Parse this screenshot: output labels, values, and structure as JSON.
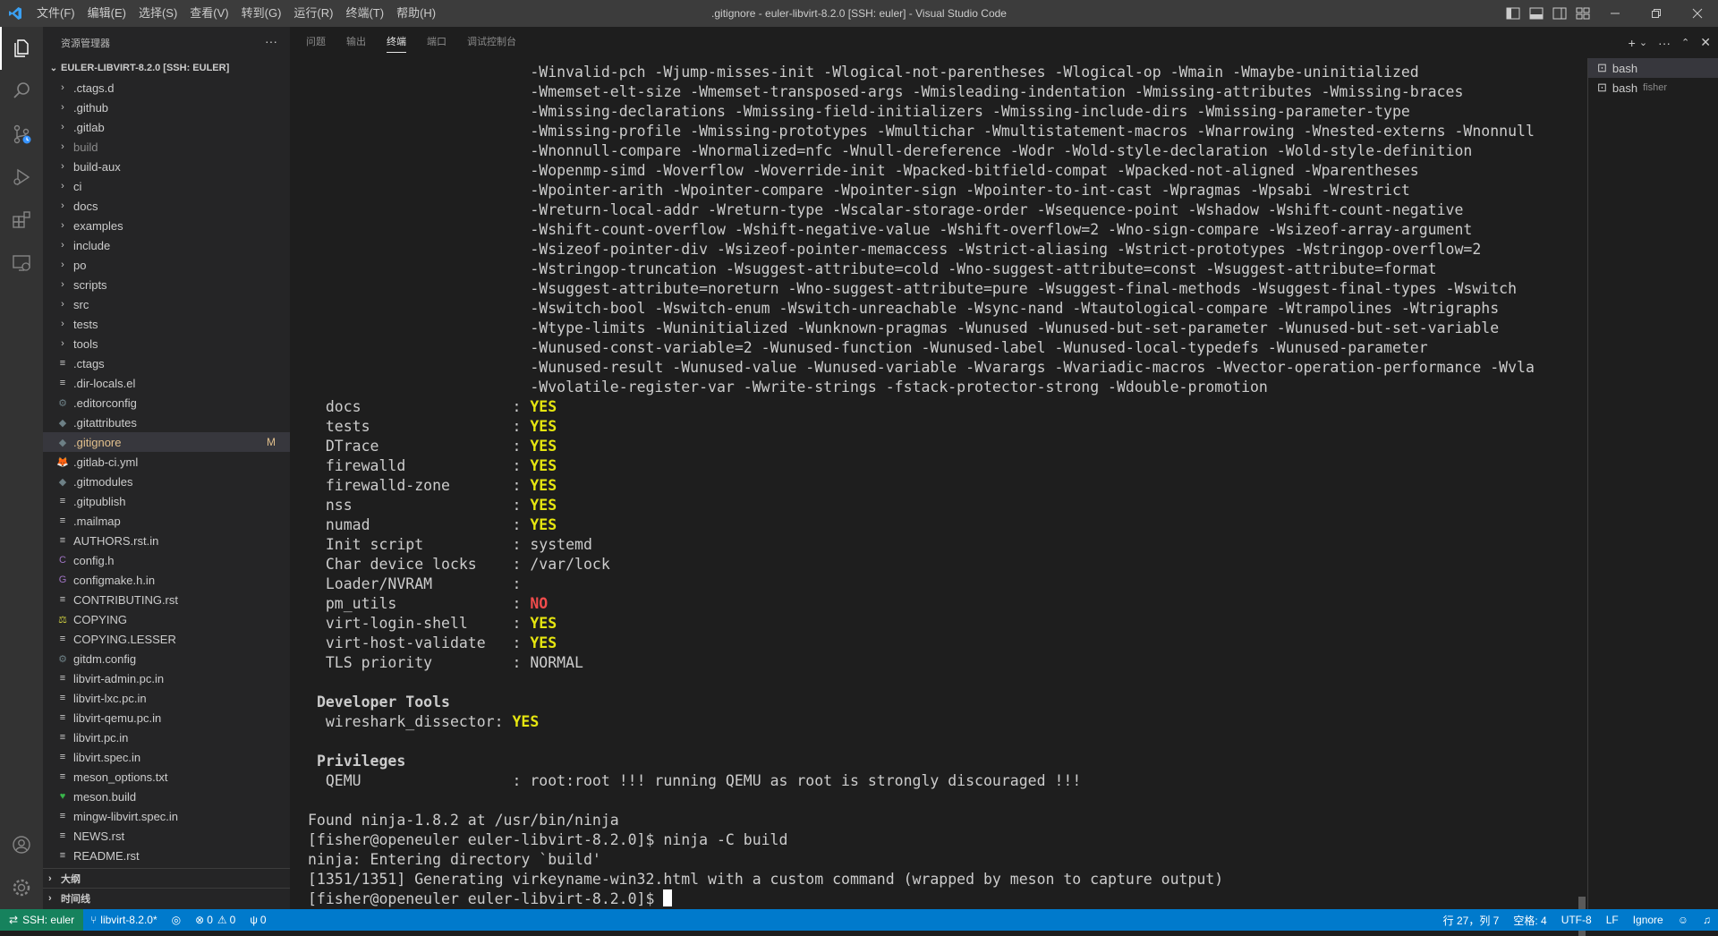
{
  "window": {
    "title": ".gitignore - euler-libvirt-8.2.0 [SSH: euler] - Visual Studio Code",
    "menu": [
      "文件(F)",
      "编辑(E)",
      "选择(S)",
      "查看(V)",
      "转到(G)",
      "运行(R)",
      "终端(T)",
      "帮助(H)"
    ]
  },
  "sidebar": {
    "header": "资源管理器",
    "more": "···",
    "root": "EULER-LIBVIRT-8.2.0 [SSH: EULER]",
    "items": [
      {
        "label": ".ctags.d",
        "type": "folder"
      },
      {
        "label": ".github",
        "type": "folder"
      },
      {
        "label": ".gitlab",
        "type": "folder"
      },
      {
        "label": "build",
        "type": "folder",
        "dim": true
      },
      {
        "label": "build-aux",
        "type": "folder"
      },
      {
        "label": "ci",
        "type": "folder"
      },
      {
        "label": "docs",
        "type": "folder"
      },
      {
        "label": "examples",
        "type": "folder"
      },
      {
        "label": "include",
        "type": "folder"
      },
      {
        "label": "po",
        "type": "folder"
      },
      {
        "label": "scripts",
        "type": "folder"
      },
      {
        "label": "src",
        "type": "folder"
      },
      {
        "label": "tests",
        "type": "folder"
      },
      {
        "label": "tools",
        "type": "folder"
      },
      {
        "label": ".ctags",
        "type": "file",
        "icon": "≡"
      },
      {
        "label": ".dir-locals.el",
        "type": "file",
        "icon": "≡"
      },
      {
        "label": ".editorconfig",
        "type": "file",
        "icon": "⚙"
      },
      {
        "label": ".gitattributes",
        "type": "file",
        "icon": "◆"
      },
      {
        "label": ".gitignore",
        "type": "file",
        "icon": "◆",
        "selected": true,
        "badge": "M"
      },
      {
        "label": ".gitlab-ci.yml",
        "type": "file",
        "icon": "🦊"
      },
      {
        "label": ".gitmodules",
        "type": "file",
        "icon": "◆"
      },
      {
        "label": ".gitpublish",
        "type": "file",
        "icon": "≡"
      },
      {
        "label": ".mailmap",
        "type": "file",
        "icon": "≡"
      },
      {
        "label": "AUTHORS.rst.in",
        "type": "file",
        "icon": "≡"
      },
      {
        "label": "config.h",
        "type": "file",
        "icon": "C"
      },
      {
        "label": "configmake.h.in",
        "type": "file",
        "icon": "G"
      },
      {
        "label": "CONTRIBUTING.rst",
        "type": "file",
        "icon": "≡"
      },
      {
        "label": "COPYING",
        "type": "file",
        "icon": "⚖"
      },
      {
        "label": "COPYING.LESSER",
        "type": "file",
        "icon": "≡"
      },
      {
        "label": "gitdm.config",
        "type": "file",
        "icon": "⚙"
      },
      {
        "label": "libvirt-admin.pc.in",
        "type": "file",
        "icon": "≡"
      },
      {
        "label": "libvirt-lxc.pc.in",
        "type": "file",
        "icon": "≡"
      },
      {
        "label": "libvirt-qemu.pc.in",
        "type": "file",
        "icon": "≡"
      },
      {
        "label": "libvirt.pc.in",
        "type": "file",
        "icon": "≡"
      },
      {
        "label": "libvirt.spec.in",
        "type": "file",
        "icon": "≡"
      },
      {
        "label": "meson_options.txt",
        "type": "file",
        "icon": "≡"
      },
      {
        "label": "meson.build",
        "type": "file",
        "icon": "♥"
      },
      {
        "label": "mingw-libvirt.spec.in",
        "type": "file",
        "icon": "≡"
      },
      {
        "label": "NEWS.rst",
        "type": "file",
        "icon": "≡"
      },
      {
        "label": "README.rst",
        "type": "file",
        "icon": "≡"
      }
    ],
    "outline": "大纲",
    "timeline": "时间线"
  },
  "panel": {
    "tabs": [
      "问题",
      "输出",
      "终端",
      "端口",
      "调试控制台"
    ],
    "active_tab": "终端"
  },
  "terminal": {
    "flags": [
      "-Winvalid-pch -Wjump-misses-init -Wlogical-not-parentheses -Wlogical-op -Wmain -Wmaybe-uninitialized",
      "-Wmemset-elt-size -Wmemset-transposed-args -Wmisleading-indentation -Wmissing-attributes -Wmissing-braces",
      "-Wmissing-declarations -Wmissing-field-initializers -Wmissing-include-dirs -Wmissing-parameter-type",
      "-Wmissing-profile -Wmissing-prototypes -Wmultichar -Wmultistatement-macros -Wnarrowing -Wnested-externs -Wnonnull",
      "-Wnonnull-compare -Wnormalized=nfc -Wnull-dereference -Wodr -Wold-style-declaration -Wold-style-definition",
      "-Wopenmp-simd -Woverflow -Woverride-init -Wpacked-bitfield-compat -Wpacked-not-aligned -Wparentheses",
      "-Wpointer-arith -Wpointer-compare -Wpointer-sign -Wpointer-to-int-cast -Wpragmas -Wpsabi -Wrestrict",
      "-Wreturn-local-addr -Wreturn-type -Wscalar-storage-order -Wsequence-point -Wshadow -Wshift-count-negative",
      "-Wshift-count-overflow -Wshift-negative-value -Wshift-overflow=2 -Wno-sign-compare -Wsizeof-array-argument",
      "-Wsizeof-pointer-div -Wsizeof-pointer-memaccess -Wstrict-aliasing -Wstrict-prototypes -Wstringop-overflow=2",
      "-Wstringop-truncation -Wsuggest-attribute=cold -Wno-suggest-attribute=const -Wsuggest-attribute=format",
      "-Wsuggest-attribute=noreturn -Wno-suggest-attribute=pure -Wsuggest-final-methods -Wsuggest-final-types -Wswitch",
      "-Wswitch-bool -Wswitch-enum -Wswitch-unreachable -Wsync-nand -Wtautological-compare -Wtrampolines -Wtrigraphs",
      "-Wtype-limits -Wuninitialized -Wunknown-pragmas -Wunused -Wunused-but-set-parameter -Wunused-but-set-variable",
      "-Wunused-const-variable=2 -Wunused-function -Wunused-label -Wunused-local-typedefs -Wunused-parameter",
      "-Wunused-result -Wunused-value -Wunused-variable -Wvarargs -Wvariadic-macros -Wvector-operation-performance -Wvla",
      "-Wvolatile-register-var -Wwrite-strings -fstack-protector-strong -Wdouble-promotion"
    ],
    "options": [
      {
        "key": "  docs                 : ",
        "value": "YES",
        "style": "yes"
      },
      {
        "key": "  tests                : ",
        "value": "YES",
        "style": "yes"
      },
      {
        "key": "  DTrace               : ",
        "value": "YES",
        "style": "yes"
      },
      {
        "key": "  firewalld            : ",
        "value": "YES",
        "style": "yes"
      },
      {
        "key": "  firewalld-zone       : ",
        "value": "YES",
        "style": "yes"
      },
      {
        "key": "  nss                  : ",
        "value": "YES",
        "style": "yes"
      },
      {
        "key": "  numad                : ",
        "value": "YES",
        "style": "yes"
      },
      {
        "key": "  Init script          : ",
        "value": "systemd",
        "style": ""
      },
      {
        "key": "  Char device locks    : ",
        "value": "/var/lock",
        "style": ""
      },
      {
        "key": "  Loader/NVRAM         : ",
        "value": "",
        "style": ""
      },
      {
        "key": "  pm_utils             : ",
        "value": "NO",
        "style": "no"
      },
      {
        "key": "  virt-login-shell     : ",
        "value": "YES",
        "style": "yes"
      },
      {
        "key": "  virt-host-validate   : ",
        "value": "YES",
        "style": "yes"
      },
      {
        "key": "  TLS priority         : ",
        "value": "NORMAL",
        "style": ""
      }
    ],
    "dev_tools_header": "Developer Tools",
    "dev_tools": [
      {
        "key": "  wireshark_dissector: ",
        "value": "YES",
        "style": "yes"
      }
    ],
    "privileges_header": "Privileges",
    "privileges": [
      {
        "key": "  QEMU                 : ",
        "value": "root:root !!! running QEMU as root is strongly discouraged !!!",
        "style": ""
      }
    ],
    "tail": [
      "Found ninja-1.8.2 at /usr/bin/ninja",
      "[fisher@openeuler euler-libvirt-8.2.0]$ ninja -C build",
      "ninja: Entering directory `build'",
      "[1351/1351] Generating virkeyname-win32.html with a custom command (wrapped by meson to capture output)"
    ],
    "prompt": "[fisher@openeuler euler-libvirt-8.2.0]$ "
  },
  "terminal_list": [
    {
      "label": "bash",
      "sub": ""
    },
    {
      "label": "bash",
      "sub": "fisher"
    }
  ],
  "statusbar": {
    "remote": "SSH: euler",
    "branch": "libvirt-8.2.0*",
    "errors": "0",
    "warnings": "0",
    "ports": "0",
    "position": "行 27，列 7",
    "spaces": "空格: 4",
    "encoding": "UTF-8",
    "eol": "LF",
    "language": "Ignore"
  }
}
